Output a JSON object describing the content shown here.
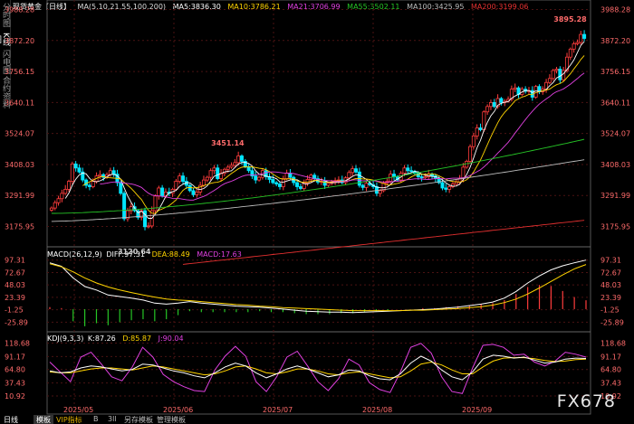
{
  "sidebar": [
    "分时图",
    "K线图",
    "闪电图",
    "合约资料"
  ],
  "main": {
    "legend": {
      "symbol": "现货黄金【日线】",
      "ma_title": "MA(5,10,21,55,100,200)",
      "ma5": "MA5:3836.30",
      "ma10": "MA10:3786.21",
      "ma21": "MA21:3706.99",
      "ma55": "MA55:3502.11",
      "ma100": "MA100:3425.95",
      "ma200": "MA200:3199.06"
    },
    "annotations": {
      "high": "3895.28",
      "mid_high": "3451.14",
      "low": "3120.64"
    }
  },
  "macd": {
    "title": "MACD(26,12,9)",
    "diff": "DIFF:97.31",
    "dea": "DEA:88.49",
    "macd": "MACD:17.63"
  },
  "kdj": {
    "title": "KDJ(9,3,3)",
    "k": "K:87.26",
    "d": "D:85.87",
    "j": "J:90.04"
  },
  "colors": {
    "up": "#ff3c3c",
    "down": "#00e6ff",
    "ma5": "#ffffff",
    "ma10": "#ffd400",
    "ma21": "#e040e0",
    "ma55": "#26c526",
    "ma100": "#bdbdbd",
    "ma200": "#e53030",
    "grid": "#4a1212",
    "label": "#ff6b6b"
  },
  "chart_data": [
    {
      "type": "candlestick",
      "title": "现货黄金【日线】",
      "y_ticks": [
        "3988.28",
        "3872.20",
        "3756.15",
        "3640.11",
        "3524.07",
        "3408.03",
        "3291.99",
        "3175.95"
      ],
      "ylim": [
        3110,
        3990
      ],
      "x_ticks": [
        "2025/05",
        "2025/06",
        "2025/07",
        "2025/08",
        "2025/09"
      ],
      "series_names": [
        "MA5",
        "MA10",
        "MA21",
        "MA55",
        "MA100",
        "MA200"
      ],
      "last_values": {
        "MA5": 3836.3,
        "MA10": 3786.21,
        "MA21": 3706.99,
        "MA55": 3502.11,
        "MA100": 3425.95,
        "MA200": 3199.06
      },
      "annotations": [
        {
          "label": "3895.28",
          "value": 3895.28
        },
        {
          "label": "3451.14",
          "value": 3451.14
        },
        {
          "label": "3120.64",
          "value": 3120.64
        }
      ],
      "close": [
        3245,
        3265,
        3280,
        3300,
        3315,
        3345,
        3410,
        3395,
        3380,
        3350,
        3330,
        3325,
        3345,
        3365,
        3370,
        3360,
        3370,
        3385,
        3372,
        3340,
        3300,
        3205,
        3235,
        3250,
        3235,
        3210,
        3235,
        3175,
        3178,
        3235,
        3290,
        3320,
        3290,
        3305,
        3300,
        3315,
        3345,
        3365,
        3345,
        3330,
        3310,
        3295,
        3305,
        3330,
        3350,
        3360,
        3385,
        3395,
        3355,
        3375,
        3390,
        3398,
        3405,
        3415,
        3440,
        3420,
        3400,
        3385,
        3365,
        3350,
        3360,
        3385,
        3362,
        3352,
        3340,
        3335,
        3325,
        3355,
        3375,
        3360,
        3340,
        3325,
        3318,
        3338,
        3352,
        3368,
        3355,
        3342,
        3345,
        3330,
        3338,
        3342,
        3348,
        3350,
        3340,
        3358,
        3378,
        3392,
        3380,
        3330,
        3322,
        3338,
        3332,
        3325,
        3300,
        3310,
        3338,
        3345,
        3372,
        3362,
        3350,
        3375,
        3395,
        3385,
        3382,
        3375,
        3362,
        3358,
        3362,
        3372,
        3365,
        3355,
        3340,
        3320,
        3315,
        3325,
        3335,
        3342,
        3355,
        3398,
        3420,
        3475,
        3515,
        3545,
        3538,
        3605,
        3625,
        3640,
        3625,
        3655,
        3640,
        3645,
        3652,
        3690,
        3695,
        3670,
        3690,
        3682,
        3685,
        3660,
        3700,
        3680,
        3690,
        3715,
        3730,
        3760,
        3765,
        3725,
        3760,
        3810,
        3840,
        3860,
        3865,
        3895,
        3880
      ]
    },
    {
      "type": "line",
      "title": "MACD(26,12,9)",
      "y_ticks": [
        "97.31",
        "72.67",
        "48.03",
        "23.39",
        "-1.25",
        "-25.89"
      ],
      "ylim": [
        -36,
        104
      ],
      "series": [
        {
          "name": "DIFF",
          "values": [
            92,
            85,
            62,
            45,
            38,
            28,
            25,
            22,
            18,
            12,
            10,
            12,
            15,
            12,
            10,
            8,
            6,
            5,
            4,
            2,
            0,
            -2,
            -4,
            -5,
            -6,
            -6,
            -7,
            -6,
            -5,
            -4,
            -3,
            -2,
            -1,
            0,
            2,
            4,
            7,
            10,
            14,
            22,
            35,
            52,
            66,
            78,
            86,
            92,
            97.31
          ]
        },
        {
          "name": "DEA",
          "values": [
            90,
            84,
            74,
            62,
            52,
            44,
            38,
            33,
            28,
            24,
            20,
            18,
            17,
            15,
            13,
            11,
            9,
            8,
            6,
            5,
            3,
            2,
            1,
            0,
            -1,
            -2,
            -3,
            -3,
            -3,
            -3,
            -3,
            -2,
            -2,
            -1,
            0,
            1,
            3,
            5,
            8,
            13,
            20,
            30,
            42,
            55,
            68,
            80,
            88.49
          ]
        },
        {
          "name": "MACD",
          "values": [
            4,
            2,
            -24,
            -34,
            -28,
            -32,
            -26,
            -22,
            -20,
            -24,
            -20,
            -12,
            -4,
            -6,
            -6,
            -6,
            -6,
            -6,
            -4,
            -6,
            -6,
            -8,
            -10,
            -10,
            -10,
            -8,
            -8,
            -6,
            -4,
            -2,
            0,
            0,
            2,
            2,
            4,
            6,
            8,
            10,
            12,
            18,
            30,
            44,
            48,
            46,
            36,
            24,
            17.63
          ]
        }
      ]
    },
    {
      "type": "line",
      "title": "KDJ(9,3,3)",
      "y_ticks": [
        "118.68",
        "91.17",
        "64.80",
        "37.43",
        "10.92"
      ],
      "ylim": [
        0,
        125
      ],
      "series": [
        {
          "name": "K",
          "values": [
            62,
            58,
            60,
            68,
            72,
            70,
            66,
            62,
            65,
            76,
            74,
            68,
            62,
            58,
            52,
            48,
            58,
            70,
            78,
            72,
            58,
            48,
            56,
            66,
            72,
            66,
            58,
            50,
            54,
            64,
            62,
            52,
            46,
            44,
            56,
            78,
            92,
            82,
            64,
            50,
            44,
            60,
            86,
            94,
            92,
            88,
            90,
            84,
            78,
            80,
            86,
            88,
            87.26
          ]
        },
        {
          "name": "D",
          "values": [
            60,
            58,
            58,
            62,
            66,
            68,
            68,
            66,
            64,
            68,
            72,
            70,
            66,
            62,
            58,
            54,
            56,
            62,
            70,
            72,
            66,
            58,
            56,
            60,
            66,
            66,
            62,
            56,
            54,
            58,
            60,
            56,
            52,
            48,
            50,
            62,
            76,
            80,
            74,
            64,
            56,
            56,
            70,
            82,
            88,
            89,
            89,
            87,
            83,
            81,
            82,
            85,
            85.87
          ]
        },
        {
          "name": "J",
          "values": [
            80,
            60,
            40,
            90,
            100,
            76,
            50,
            42,
            70,
            110,
            90,
            55,
            40,
            30,
            22,
            20,
            64,
            92,
            112,
            92,
            40,
            20,
            50,
            90,
            102,
            72,
            40,
            22,
            46,
            86,
            74,
            38,
            24,
            18,
            60,
            110,
            118,
            98,
            50,
            20,
            16,
            68,
            114,
            116,
            110,
            94,
            96,
            80,
            72,
            82,
            100,
            96,
            90.04
          ]
        }
      ]
    }
  ],
  "x_axis": [
    "2025/05",
    "2025/06",
    "2025/07",
    "2025/08",
    "2025/09"
  ],
  "bottom_bar": {
    "tab1": "日线",
    "tab2": "模板",
    "t1": "VIP指标",
    "t2": "B",
    "t3": "3ll",
    "t4": "另存模板",
    "t5": "管理模板"
  },
  "watermark": "FX678"
}
